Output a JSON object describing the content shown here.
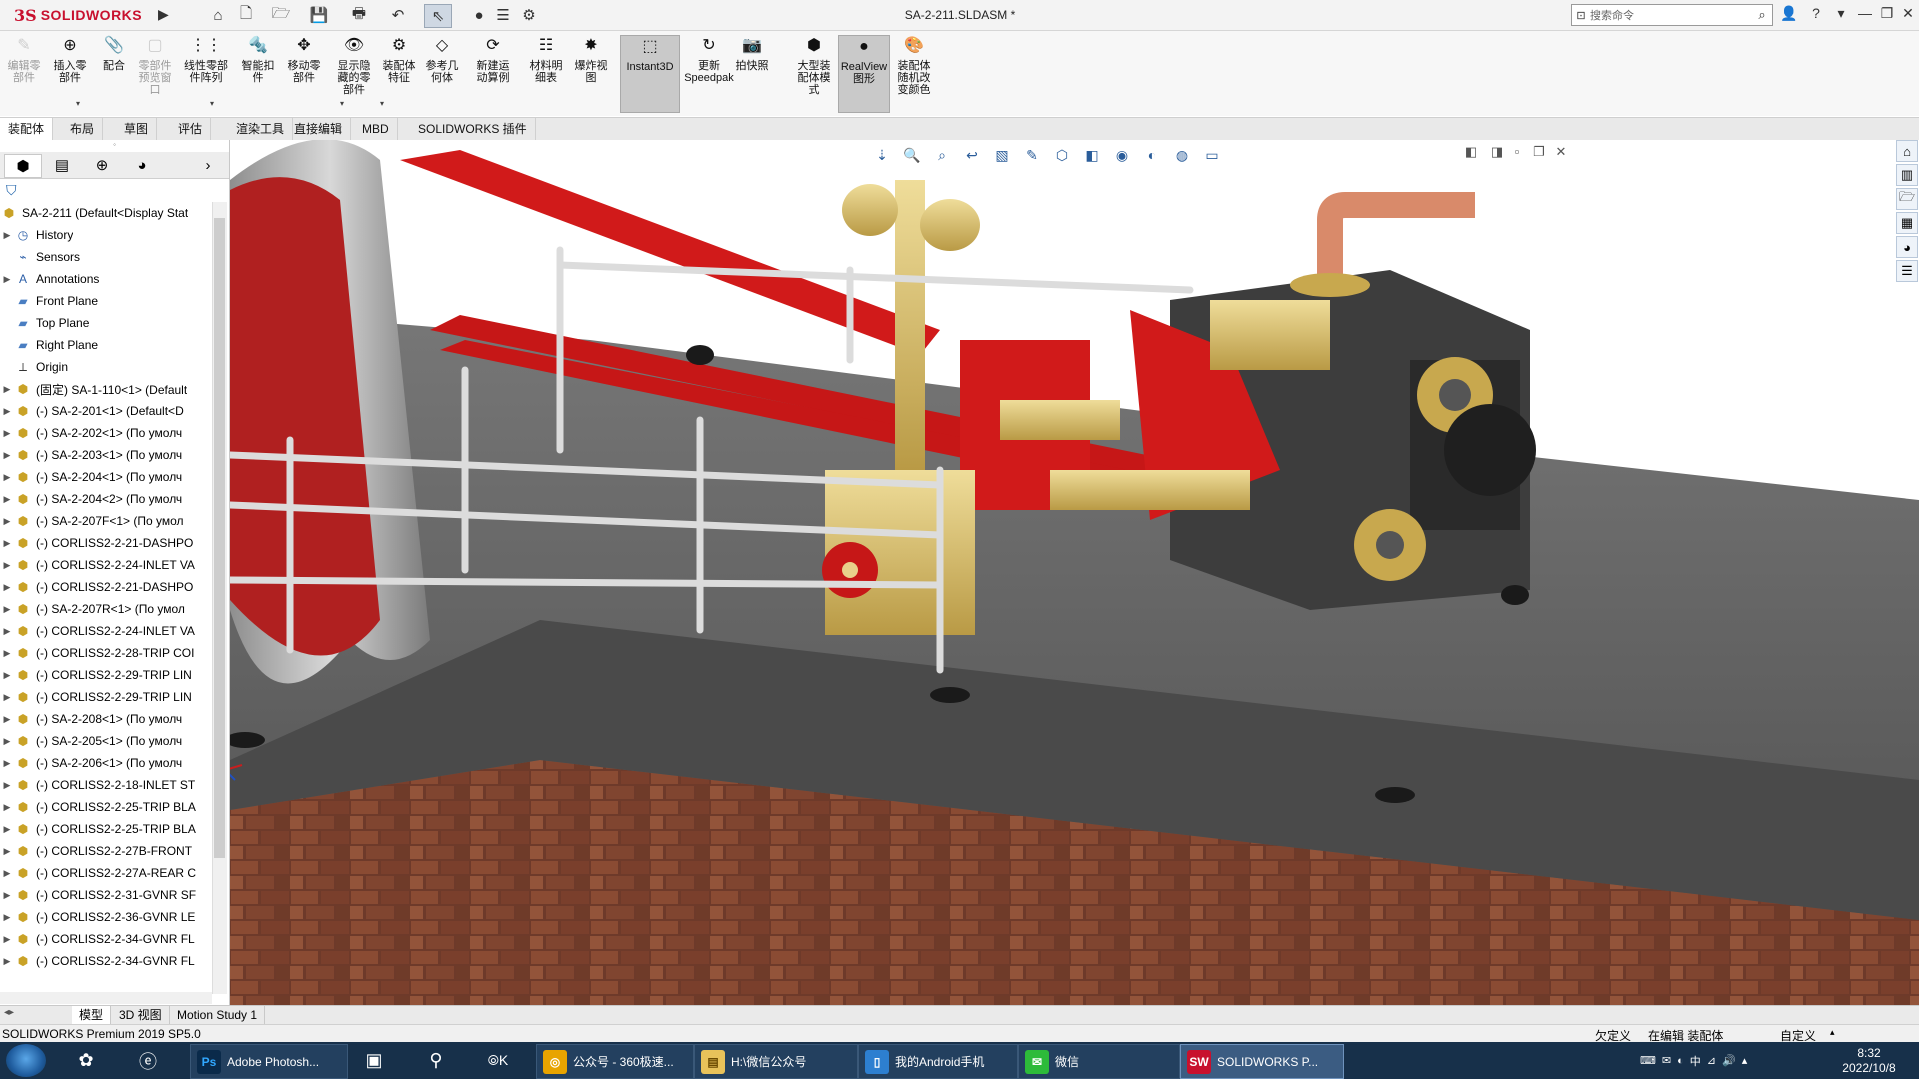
{
  "app": {
    "logo_ds": "3S",
    "logo_text": "SOLIDWORKS",
    "doc_title": "SA-2-211.SLDASM *",
    "search_placeholder": "搜索命令"
  },
  "quick_access": [
    "home-icon",
    "new-doc-icon",
    "open-icon",
    "save-icon",
    "print-icon",
    "undo-icon",
    "select-icon",
    "traffic-light-icon",
    "options-icon",
    "gear-icon"
  ],
  "ribbon": {
    "buttons": [
      {
        "id": "edit-part",
        "label": "编辑零\n部件",
        "disabled": true,
        "icon": "✎"
      },
      {
        "id": "insert-part",
        "label": "插入零\n部件",
        "disabled": false,
        "icon": "⊕"
      },
      {
        "id": "mate",
        "label": "配合",
        "disabled": false,
        "icon": "📎"
      },
      {
        "id": "part-preview",
        "label": "零部件\n预览窗\n口",
        "disabled": true,
        "icon": "▢"
      },
      {
        "id": "linear-pattern",
        "label": "线性零部\n件阵列",
        "disabled": false,
        "icon": "⋮⋮"
      },
      {
        "id": "smart-fasteners",
        "label": "智能扣\n件",
        "disabled": false,
        "icon": "🔩"
      },
      {
        "id": "move-part",
        "label": "移动零\n部件",
        "disabled": false,
        "icon": "✥"
      },
      {
        "id": "show-hidden",
        "label": "显示隐\n藏的零\n部件",
        "disabled": false,
        "icon": "👁"
      },
      {
        "id": "assembly-features",
        "label": "装配体\n特征",
        "disabled": false,
        "icon": "⚙"
      },
      {
        "id": "reference-geometry",
        "label": "参考几\n何体",
        "disabled": false,
        "icon": "◇"
      },
      {
        "id": "new-motion-study",
        "label": "新建运\n动算例",
        "disabled": false,
        "icon": "⟳"
      },
      {
        "id": "bom",
        "label": "材料明\n细表",
        "disabled": false,
        "icon": "☷"
      },
      {
        "id": "exploded-view",
        "label": "爆炸视\n图",
        "disabled": false,
        "icon": "✸"
      },
      {
        "id": "instant3d",
        "label": "Instant3D",
        "disabled": false,
        "active": true,
        "icon": "⬚"
      },
      {
        "id": "update-speedpak",
        "label": "更新\nSpeedpak",
        "disabled": false,
        "icon": "↻"
      },
      {
        "id": "snapshot",
        "label": "拍快照",
        "disabled": false,
        "icon": "📷"
      },
      {
        "id": "large-assembly",
        "label": "大型装\n配体模\n式",
        "disabled": false,
        "icon": "⬢"
      },
      {
        "id": "realview",
        "label": "RealView\n图形",
        "disabled": false,
        "active": true,
        "icon": "●"
      },
      {
        "id": "assembly-color",
        "label": "装配体\n随机改\n变颜色",
        "disabled": false,
        "icon": "🎨"
      }
    ]
  },
  "cm_tabs": [
    "装配体",
    "布局",
    "草图",
    "评估",
    "渲染工具",
    "直接编辑",
    "MBD",
    "SOLIDWORKS 插件"
  ],
  "feature_tree": {
    "root": "SA-2-211  (Default<Display Stat",
    "items": [
      {
        "label": "History",
        "icon": "history",
        "expand": true
      },
      {
        "label": "Sensors",
        "icon": "sensor",
        "expand": false
      },
      {
        "label": "Annotations",
        "icon": "annotation",
        "expand": true
      },
      {
        "label": "Front Plane",
        "icon": "plane",
        "expand": false
      },
      {
        "label": "Top Plane",
        "icon": "plane",
        "expand": false
      },
      {
        "label": "Right Plane",
        "icon": "plane",
        "expand": false
      },
      {
        "label": "Origin",
        "icon": "origin",
        "expand": false
      },
      {
        "label": "(固定) SA-1-110<1> (Default",
        "icon": "assembly",
        "expand": true
      },
      {
        "label": "(-) SA-2-201<1> (Default<D",
        "icon": "part",
        "expand": true
      },
      {
        "label": "(-) SA-2-202<1> (По умолч",
        "icon": "part",
        "expand": true
      },
      {
        "label": "(-) SA-2-203<1> (По умолч",
        "icon": "part",
        "expand": true
      },
      {
        "label": "(-) SA-2-204<1> (По умолч",
        "icon": "part",
        "expand": true
      },
      {
        "label": "(-) SA-2-204<2> (По умолч",
        "icon": "part",
        "expand": true
      },
      {
        "label": "(-) SA-2-207F<1> (По умол",
        "icon": "part",
        "expand": true
      },
      {
        "label": "(-) CORLISS2-2-21-DASHPO",
        "icon": "part",
        "expand": true
      },
      {
        "label": "(-) CORLISS2-2-24-INLET VA",
        "icon": "part",
        "expand": true
      },
      {
        "label": "(-) CORLISS2-2-21-DASHPO",
        "icon": "part",
        "expand": true
      },
      {
        "label": "(-) SA-2-207R<1> (По умол",
        "icon": "part",
        "expand": true
      },
      {
        "label": "(-) CORLISS2-2-24-INLET VA",
        "icon": "part",
        "expand": true
      },
      {
        "label": "(-) CORLISS2-2-28-TRIP COI",
        "icon": "part",
        "expand": true
      },
      {
        "label": "(-) CORLISS2-2-29-TRIP LIN",
        "icon": "part",
        "expand": true
      },
      {
        "label": "(-) CORLISS2-2-29-TRIP LIN",
        "icon": "part",
        "expand": true
      },
      {
        "label": "(-) SA-2-208<1> (По умолч",
        "icon": "part",
        "expand": true
      },
      {
        "label": "(-) SA-2-205<1> (По умолч",
        "icon": "part",
        "expand": true
      },
      {
        "label": "(-) SA-2-206<1> (По умолч",
        "icon": "part",
        "expand": true
      },
      {
        "label": "(-) CORLISS2-2-18-INLET ST",
        "icon": "part",
        "expand": true
      },
      {
        "label": "(-) CORLISS2-2-25-TRIP BLA",
        "icon": "part",
        "expand": true
      },
      {
        "label": "(-) CORLISS2-2-25-TRIP BLA",
        "icon": "part",
        "expand": true
      },
      {
        "label": "(-) CORLISS2-2-27B-FRONT",
        "icon": "part",
        "expand": true
      },
      {
        "label": "(-) CORLISS2-2-27A-REAR C",
        "icon": "part",
        "expand": true
      },
      {
        "label": "(-) CORLISS2-2-31-GVNR SF",
        "icon": "part",
        "expand": true
      },
      {
        "label": "(-) CORLISS2-2-36-GVNR LE",
        "icon": "part",
        "expand": true
      },
      {
        "label": "(-) CORLISS2-2-34-GVNR FL",
        "icon": "part",
        "expand": true
      },
      {
        "label": "(-) CORLISS2-2-34-GVNR FL",
        "icon": "part",
        "expand": true
      }
    ]
  },
  "bottom_tabs": [
    "模型",
    "3D 视图",
    "Motion Study 1"
  ],
  "status": {
    "left": "SOLIDWORKS Premium 2019 SP5.0",
    "under_defined": "欠定义",
    "editing": "在编辑 装配体",
    "custom": "自定义"
  },
  "taskbar": {
    "windows": [
      {
        "label": "Adobe Photosh...",
        "icon": "Ps",
        "color": "#0a2a4a",
        "fg": "#31a8ff"
      },
      {
        "label": "公众号 - 360极速...",
        "icon": "◎",
        "color": "#e8a400",
        "fg": "#fff"
      },
      {
        "label": "H:\\微信公众号",
        "icon": "▤",
        "color": "#e8c25a",
        "fg": "#6b4a00"
      },
      {
        "label": "我的Android手机",
        "icon": "▯",
        "color": "#2d7fd0",
        "fg": "#fff"
      },
      {
        "label": "微信",
        "icon": "✉",
        "color": "#2dbb3a",
        "fg": "#fff"
      },
      {
        "label": "SOLIDWORKS P...",
        "icon": "SW",
        "color": "#c8102e",
        "fg": "#fff"
      }
    ],
    "time": "8:32",
    "date": "2022/10/8"
  }
}
